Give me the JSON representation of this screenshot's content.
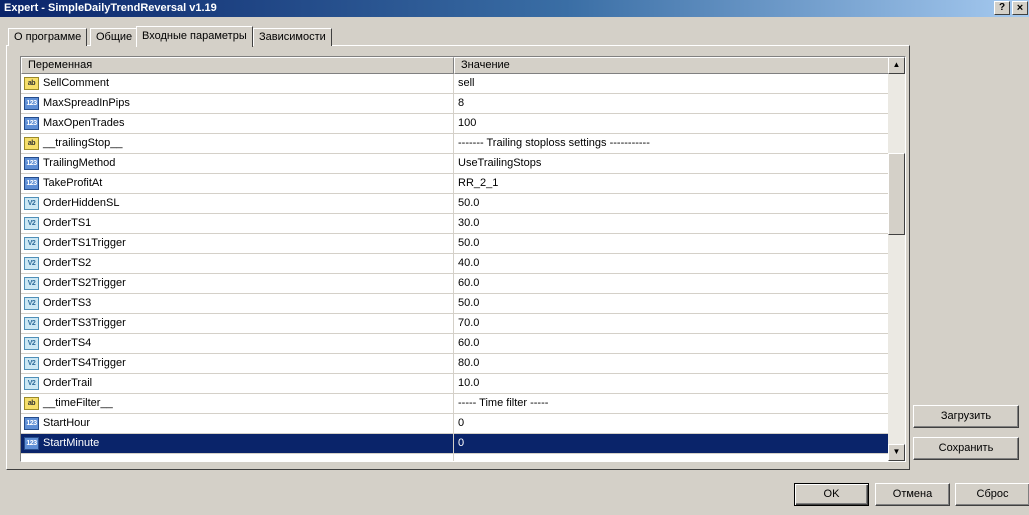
{
  "window": {
    "title": "Expert - SimpleDailyTrendReversal v1.19",
    "help_label": "?",
    "close_label": "×"
  },
  "tabs": [
    {
      "label": "О программе"
    },
    {
      "label": "Общие"
    },
    {
      "label": "Входные параметры"
    },
    {
      "label": "Зависимости"
    }
  ],
  "grid": {
    "headers": {
      "variable": "Переменная",
      "value": "Значение"
    },
    "rows": [
      {
        "type": "ab",
        "icon_text": "ab",
        "name": "SellComment",
        "value": "sell"
      },
      {
        "type": "int",
        "icon_text": "123",
        "name": "MaxSpreadInPips",
        "value": "8"
      },
      {
        "type": "int",
        "icon_text": "123",
        "name": "MaxOpenTrades",
        "value": "100"
      },
      {
        "type": "ab",
        "icon_text": "ab",
        "name": "__trailingStop__",
        "value": "------- Trailing stoploss settings -----------"
      },
      {
        "type": "int",
        "icon_text": "123",
        "name": "TrailingMethod",
        "value": "UseTrailingStops"
      },
      {
        "type": "int",
        "icon_text": "123",
        "name": "TakeProfitAt",
        "value": "RR_2_1"
      },
      {
        "type": "dbl",
        "icon_text": "V2",
        "name": "OrderHiddenSL",
        "value": "50.0"
      },
      {
        "type": "dbl",
        "icon_text": "V2",
        "name": "OrderTS1",
        "value": "30.0"
      },
      {
        "type": "dbl",
        "icon_text": "V2",
        "name": "OrderTS1Trigger",
        "value": "50.0"
      },
      {
        "type": "dbl",
        "icon_text": "V2",
        "name": "OrderTS2",
        "value": "40.0"
      },
      {
        "type": "dbl",
        "icon_text": "V2",
        "name": "OrderTS2Trigger",
        "value": "60.0"
      },
      {
        "type": "dbl",
        "icon_text": "V2",
        "name": "OrderTS3",
        "value": "50.0"
      },
      {
        "type": "dbl",
        "icon_text": "V2",
        "name": "OrderTS3Trigger",
        "value": "70.0"
      },
      {
        "type": "dbl",
        "icon_text": "V2",
        "name": "OrderTS4",
        "value": "60.0"
      },
      {
        "type": "dbl",
        "icon_text": "V2",
        "name": "OrderTS4Trigger",
        "value": "80.0"
      },
      {
        "type": "dbl",
        "icon_text": "V2",
        "name": "OrderTrail",
        "value": "10.0"
      },
      {
        "type": "ab",
        "icon_text": "ab",
        "name": "__timeFilter__",
        "value": "----- Time filter -----"
      },
      {
        "type": "int",
        "icon_text": "123",
        "name": "StartHour",
        "value": "0"
      },
      {
        "type": "int",
        "icon_text": "123",
        "name": "StartMinute",
        "value": "0",
        "selected": true
      }
    ]
  },
  "side_buttons": {
    "load": "Загрузить",
    "save": "Сохранить"
  },
  "footer_buttons": {
    "ok": "OK",
    "cancel": "Отмена",
    "reset": "Сброс"
  },
  "icons": {
    "scroll_up": "scroll-up-arrow-icon",
    "scroll_down": "scroll-down-arrow-icon"
  },
  "colors": {
    "selection": "#0a246a",
    "titlebar": "#0a246a",
    "face": "#d4d0c8"
  }
}
